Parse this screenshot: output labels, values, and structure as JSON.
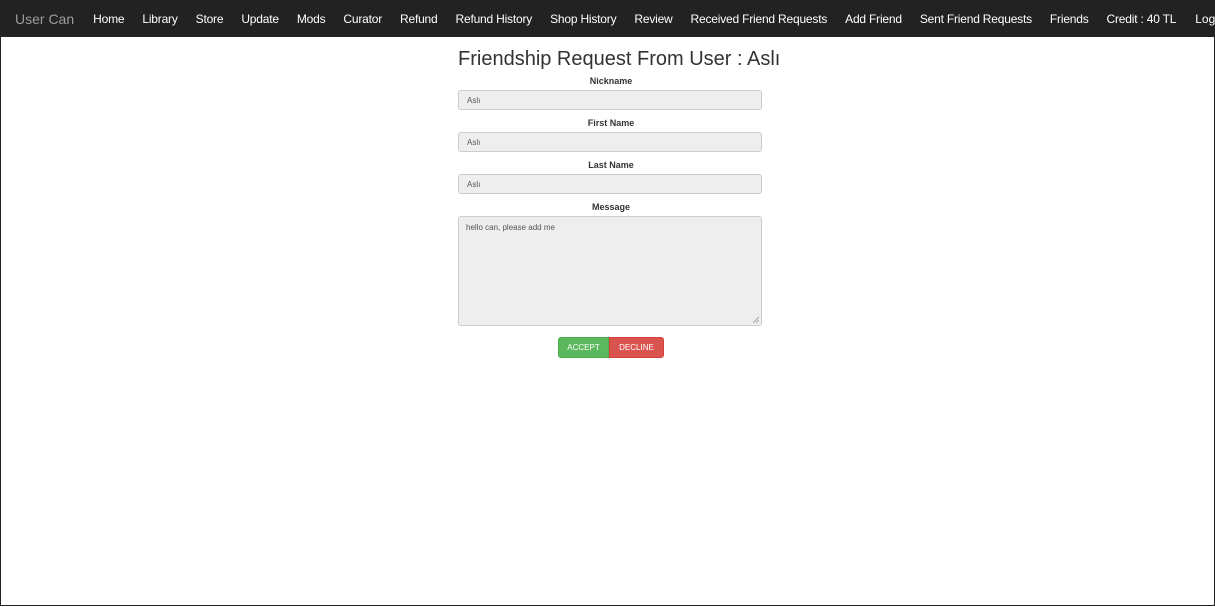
{
  "navbar": {
    "brand": "User Can",
    "items": [
      {
        "label": "Home"
      },
      {
        "label": "Library"
      },
      {
        "label": "Store"
      },
      {
        "label": "Update"
      },
      {
        "label": "Mods"
      },
      {
        "label": "Curator"
      },
      {
        "label": "Refund"
      },
      {
        "label": "Refund History"
      },
      {
        "label": "Shop History"
      },
      {
        "label": "Review"
      },
      {
        "label": "Received Friend Requests"
      },
      {
        "label": "Add Friend"
      },
      {
        "label": "Sent Friend Requests"
      },
      {
        "label": "Friends"
      },
      {
        "label": "Credit : 40 TL"
      }
    ],
    "logout": "Log Out"
  },
  "page": {
    "title": "Friendship Request From User : Aslı"
  },
  "form": {
    "nickname": {
      "label": "Nickname",
      "value": "Aslı"
    },
    "first_name": {
      "label": "First Name",
      "value": "Aslı"
    },
    "last_name": {
      "label": "Last Name",
      "value": "Aslı"
    },
    "message": {
      "label": "Message",
      "value": "hello can, please add me"
    }
  },
  "actions": {
    "accept_label": "ACCEPT",
    "decline_label": "DECLINE"
  },
  "colors": {
    "navbar_bg": "#222222",
    "accept": "#5cb85c",
    "decline": "#d9534f"
  }
}
